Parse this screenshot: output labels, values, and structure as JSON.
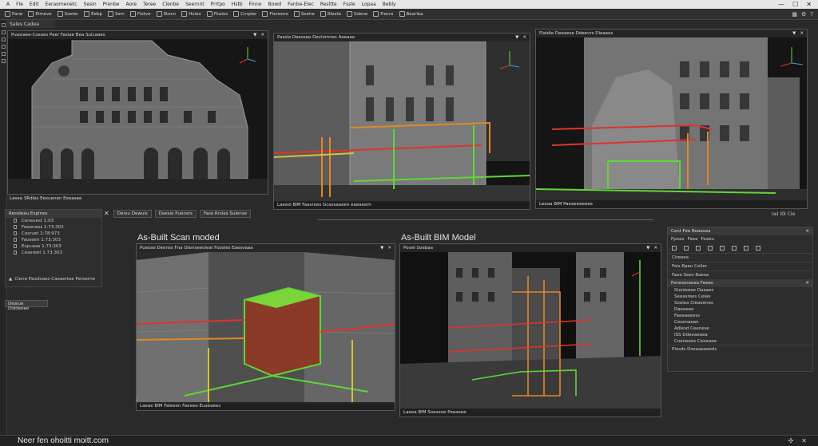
{
  "menubar": {
    "items": [
      "A",
      "Fle",
      "Edit",
      "Eeraomenetc",
      "Sesin",
      "Prenbe",
      "Aore",
      "Teree",
      "Clenbe",
      "Seernnt",
      "Prrtpo",
      "Hstb",
      "Finno",
      "Bowd",
      "Fenbe-Elec",
      "Resltte",
      "Fssle",
      "Lopaa",
      "Bebly"
    ],
    "winbtns": [
      "—",
      "☐",
      "✕"
    ]
  },
  "toolbar": {
    "items": [
      "Pane",
      "Elmeve",
      "Soeler",
      "Eebp",
      "Ssm",
      "Flotve",
      "Stecn",
      "Hxleo",
      "Fkalos",
      "Cnrpler",
      "Fleresne",
      "Seehe",
      "Rleste",
      "Sdene",
      "Fiecre",
      "Bearlea"
    ]
  },
  "left_panel": {
    "tab": "Sales Cadea",
    "explorer_title": "Resideau Explnes",
    "rows": [
      "Ceneuest 1:03",
      "Feeanees 1:73:303",
      "Cosruet 1:78:973",
      "Faoselm 1:73:303",
      "Eopuase 1:73:303",
      "Cesereet 1:73:303"
    ],
    "warning": "Ciene Fiesdvaes Caeaertae Pereerne",
    "button": "Deaiue Dlddeeee"
  },
  "viewports": {
    "v1": {
      "title": "Puasiaee-Cosaes Paer  Fasiae Bea Sulcaaes",
      "footer": "Lasea 3Rdles Eexuenen Eeeasee"
    },
    "v2": {
      "title": "Passla Deessee Devlomnes Aeeaae",
      "footer": "Laeesl BIM  Faasroes Gcassaaeen eaeaeem"
    },
    "v3": {
      "title": "Plaidie Deeaese Ddeevrs Dieaees",
      "footer": "Leeaa BIM  Paeaeeeeeee"
    },
    "v4": {
      "title": "Pueose Deenss  Fna Otenseeoleal Foosies  Eaesvaaa",
      "footer": "Laeae BIM  Faleeen Faeeee Euaeaees"
    },
    "v5": {
      "title": "Pooel Soebaa",
      "footer": "Laeea BIM  Soeseoe Peeaeee"
    }
  },
  "mid_bar": {
    "close": "✕",
    "buttons": [
      "Dersu Dewuis",
      "Daesie Puensrs",
      "Fase Rrsles Sulense"
    ]
  },
  "labels": {
    "scan": "As-Built Scan moded",
    "bim": "As-Built BIM Model"
  },
  "zoom": {
    "text": "I≡I  I0I  Cie"
  },
  "right_panel": {
    "title": "Cent Fee Beaesea",
    "tabs": [
      "Fpeax",
      "Faea",
      "Feabu"
    ],
    "line1": "Cireeea",
    "line2": "Feis Baeo Celier",
    "line3": "Faea Sees Baesa",
    "section2": "Feneseraeaa Feees",
    "tree": [
      "Stoidseee Daaaes",
      "Seeasrees Ceiee",
      "Soeiea Cleaeenes",
      "Daeaeee",
      "Faeeaeeess",
      "Cesenaean",
      "Adlesd Ceenese",
      "ISS Ddeeaeaea",
      "Coeneees Ceeeaee"
    ],
    "footer": "Plasds Dseaaeaeeds"
  },
  "status": {
    "url": "Neer fen ohoitti moitt.com"
  },
  "colors": {
    "pipe_red": "#e0332b",
    "pipe_orange": "#e2872a",
    "pipe_green": "#5fd838",
    "pipe_yellow": "#d8c236",
    "bg": "#2a2a2a"
  }
}
